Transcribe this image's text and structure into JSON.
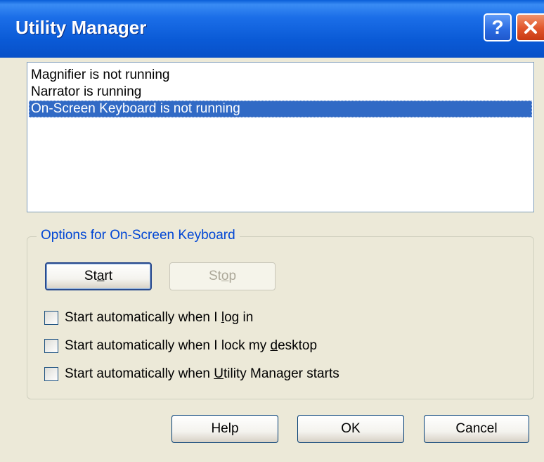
{
  "window": {
    "title": "Utility Manager",
    "help_glyph": "?"
  },
  "list": {
    "items": [
      {
        "label": "Magnifier is not running",
        "selected": false
      },
      {
        "label": "Narrator is running",
        "selected": false
      },
      {
        "label": "On-Screen Keyboard is not running",
        "selected": true
      }
    ]
  },
  "options": {
    "group_label": "Options for On-Screen Keyboard",
    "start_prefix": "St",
    "start_mnemonic": "a",
    "start_suffix": "rt",
    "stop_prefix": "St",
    "stop_mnemonic": "o",
    "stop_suffix": "p",
    "checkboxes": [
      {
        "prefix": "Start automatically when I ",
        "mnemonic": "l",
        "suffix": "og in",
        "checked": false
      },
      {
        "prefix": "Start automatically when I lock my ",
        "mnemonic": "d",
        "suffix": "esktop",
        "checked": false
      },
      {
        "prefix": "Start automatically when ",
        "mnemonic": "U",
        "suffix": "tility Manager starts",
        "checked": false
      }
    ]
  },
  "footer": {
    "help_label": "Help",
    "ok_label": "OK",
    "cancel_label": "Cancel"
  },
  "colors": {
    "titlebar": "#0a5ad6",
    "selection": "#316ac5",
    "group_label": "#0046d5",
    "close_button": "#e0552a"
  },
  "icons": {
    "help": "question-mark-icon",
    "close": "close-x-icon"
  }
}
